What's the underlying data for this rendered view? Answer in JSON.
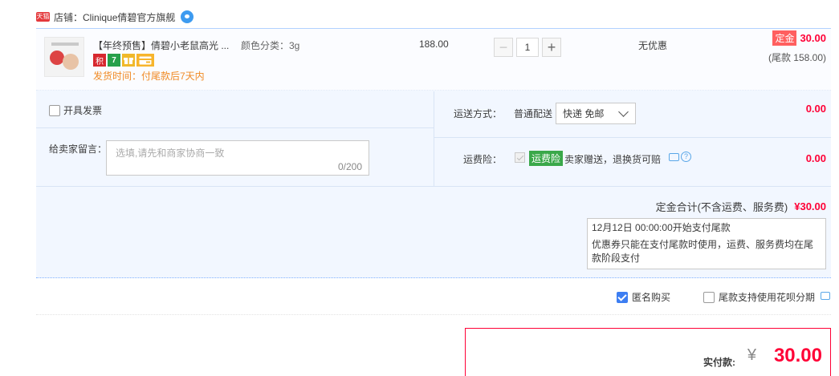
{
  "shop": {
    "badge": "天猫",
    "label": "店铺：",
    "name": "Clinique倩碧官方旗舰"
  },
  "item": {
    "title": "【年终预售】倩碧小老鼠高光 ...",
    "spec": "颜色分类：3g",
    "badges": [
      "积",
      "7",
      "gift-icon",
      "card-icon"
    ],
    "ship_time": "发货时间：付尾款后7天内",
    "price": "188.00",
    "quantity": "1",
    "discount": "无优惠",
    "deposit_tag": "定金",
    "deposit_amount": "30.00",
    "balance": "(尾款 158.00)"
  },
  "invoice": {
    "label": "开具发票",
    "checked": false
  },
  "message": {
    "label": "给卖家留言：",
    "placeholder": "选填,请先和商家协商一致",
    "count": "0/200"
  },
  "shipping": {
    "label": "运送方式：",
    "type": "普通配送",
    "selected": "快递 免邮",
    "amount": "0.00"
  },
  "insurance": {
    "label": "运费险：",
    "tag": "运费险",
    "desc": "卖家赠送，退换货可赔",
    "amount": "0.00",
    "icons": [
      "chat-icon",
      "help-icon"
    ]
  },
  "summary": {
    "label": "定金合计(不含运费、服务费)",
    "amount": "¥30.00",
    "notice_line1": "12月12日 00:00:00开始支付尾款",
    "notice_line2": "优惠券只能在支付尾款时使用，运费、服务费均在尾款阶段支付"
  },
  "options": {
    "anonymous_label": "匿名购买",
    "anonymous_checked": true,
    "huabei_label": "尾款支持使用花呗分期",
    "huabei_checked": false
  },
  "total": {
    "label": "实付款:",
    "symbol": "¥",
    "amount": "30.00"
  },
  "colors": {
    "accent_red": "#ff0036",
    "box_bg": "#f2f7ff",
    "border_blue": "#b2d1ff",
    "checkbox_blue": "#3d7ef2",
    "ship_time_orange": "#f08a24"
  }
}
